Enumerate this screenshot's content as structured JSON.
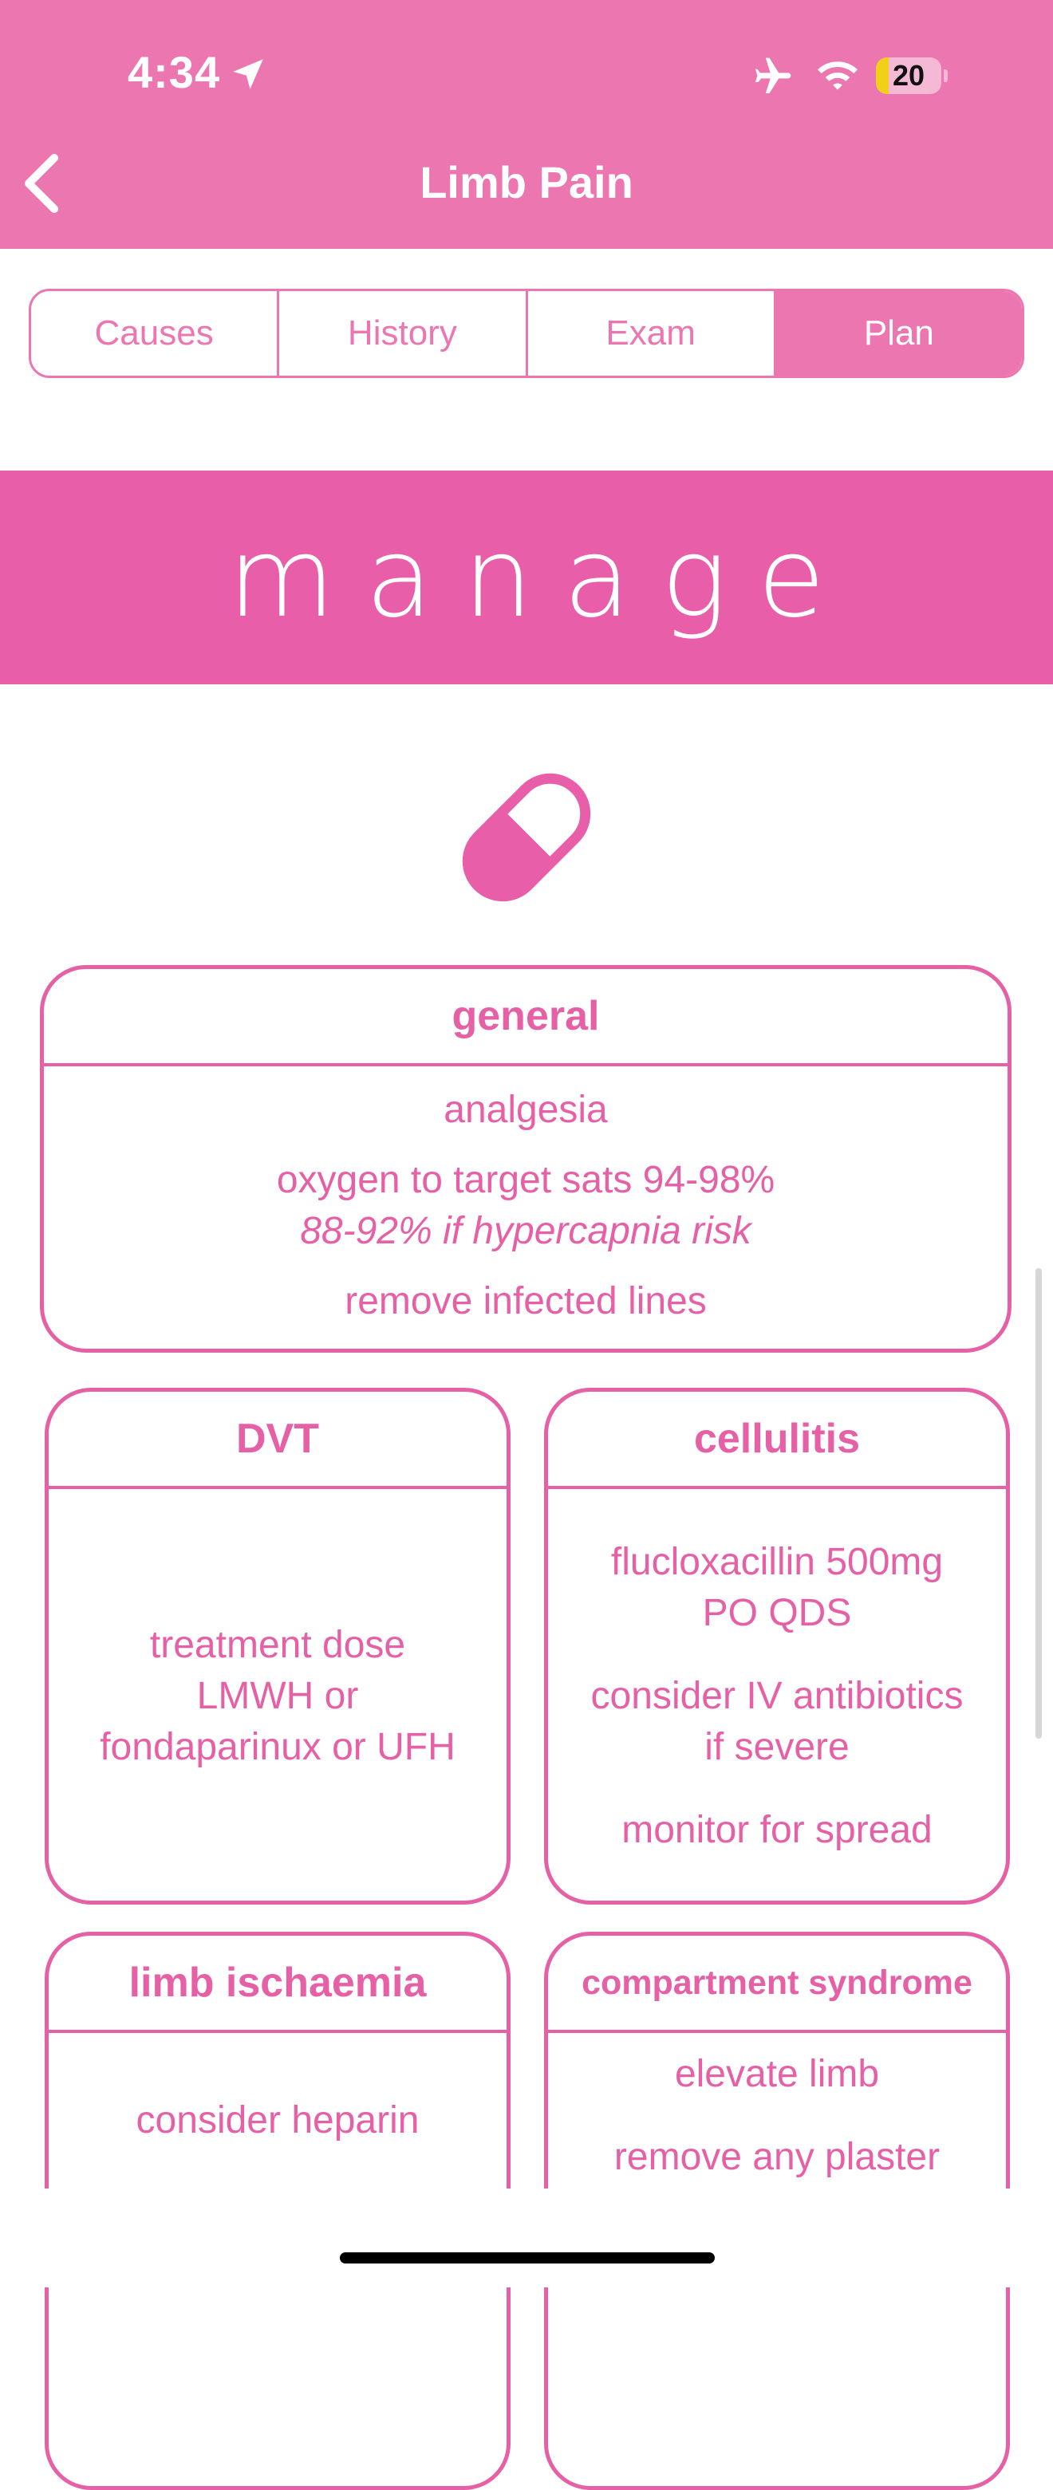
{
  "status_bar": {
    "time": "4:34",
    "battery": "20",
    "battery_level": 0.2
  },
  "nav": {
    "title": "Limb Pain"
  },
  "tabs": [
    {
      "label": "Causes",
      "active": false
    },
    {
      "label": "History",
      "active": false
    },
    {
      "label": "Exam",
      "active": false
    },
    {
      "label": "Plan",
      "active": true
    }
  ],
  "banner": {
    "title": "manage"
  },
  "icons": {
    "pill": "pill-icon",
    "back": "chevron-left-icon"
  },
  "colors": {
    "header": "#ec76b0",
    "banner": "#e95ea8",
    "accent": "#e660a6"
  },
  "cards": {
    "general": {
      "title": "general",
      "items": [
        "analgesia",
        "oxygen to target sats 94-98%",
        "88-92% if hypercapnia risk",
        "remove infected lines"
      ]
    },
    "dvt": {
      "title": "DVT",
      "items": [
        "treatment dose",
        "LMWH or",
        "fondaparinux or UFH"
      ]
    },
    "cellulitis": {
      "title": "cellulitis",
      "items": [
        "flucloxacillin 500mg",
        "PO QDS",
        "consider IV antibiotics",
        "if severe",
        "monitor for spread"
      ]
    },
    "limb_ischaemia": {
      "title": "limb ischaemia",
      "items": [
        "consider heparin"
      ]
    },
    "compartment_syndrome": {
      "title": "compartment syndrome",
      "items": [
        "elevate limb",
        "remove any plaster"
      ]
    }
  }
}
